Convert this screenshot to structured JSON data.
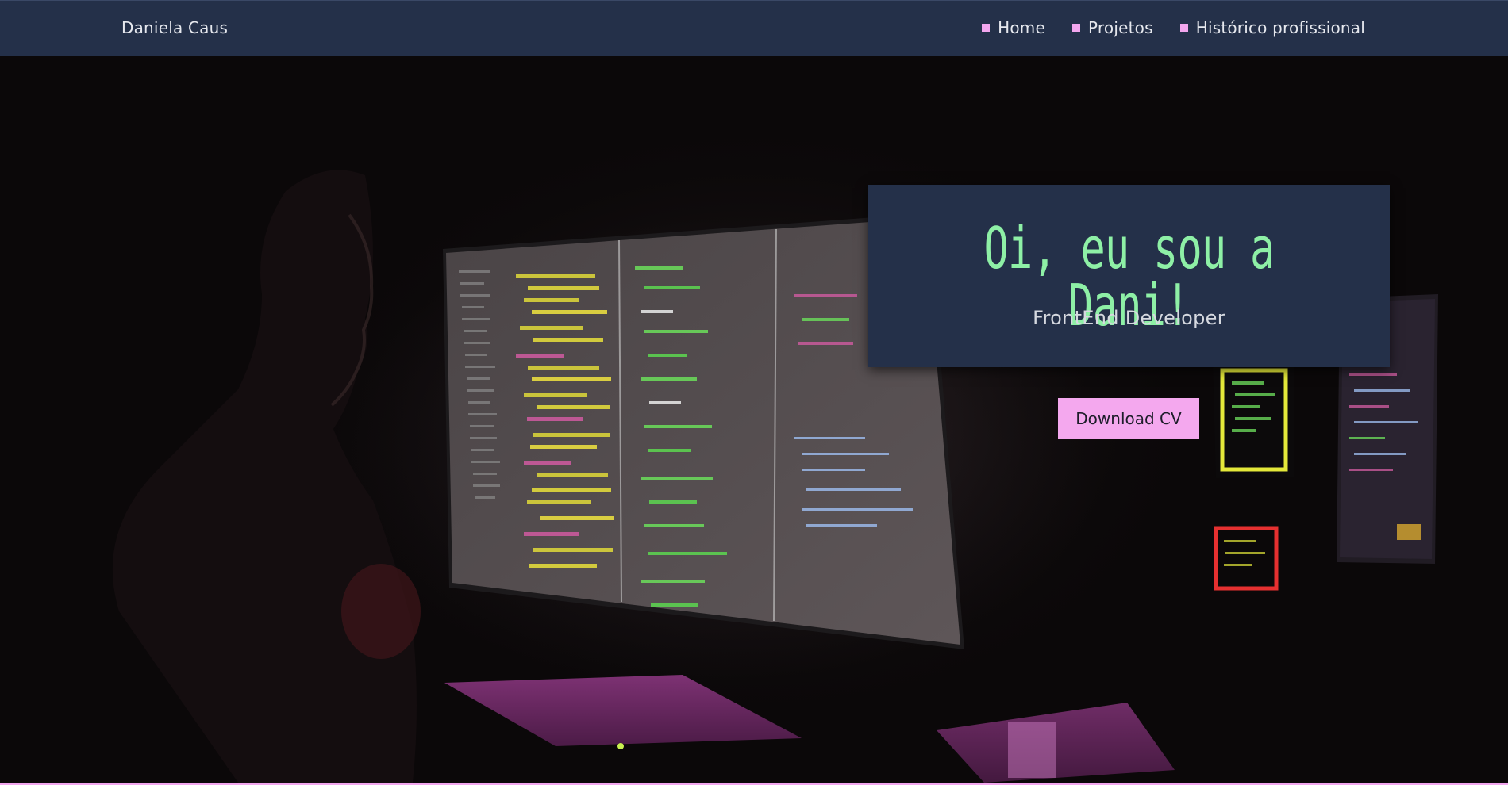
{
  "navbar": {
    "brand": "Daniela Caus",
    "links": [
      {
        "label": "Home"
      },
      {
        "label": "Projetos"
      },
      {
        "label": "Histórico profissional"
      }
    ]
  },
  "hero": {
    "title": "Oi, eu sou a Dani!",
    "subtitle": "FrontEnd Developer",
    "cta_label": "Download CV",
    "background_image": "person-at-computer-with-code-monitors"
  },
  "colors": {
    "navbar_bg": "#243049",
    "accent_pink": "#f4a8ee",
    "title_green": "#8ef0a6",
    "text_light": "#e6e8ee"
  },
  "icons": {
    "nav_bullet": "square-bullet-icon"
  }
}
